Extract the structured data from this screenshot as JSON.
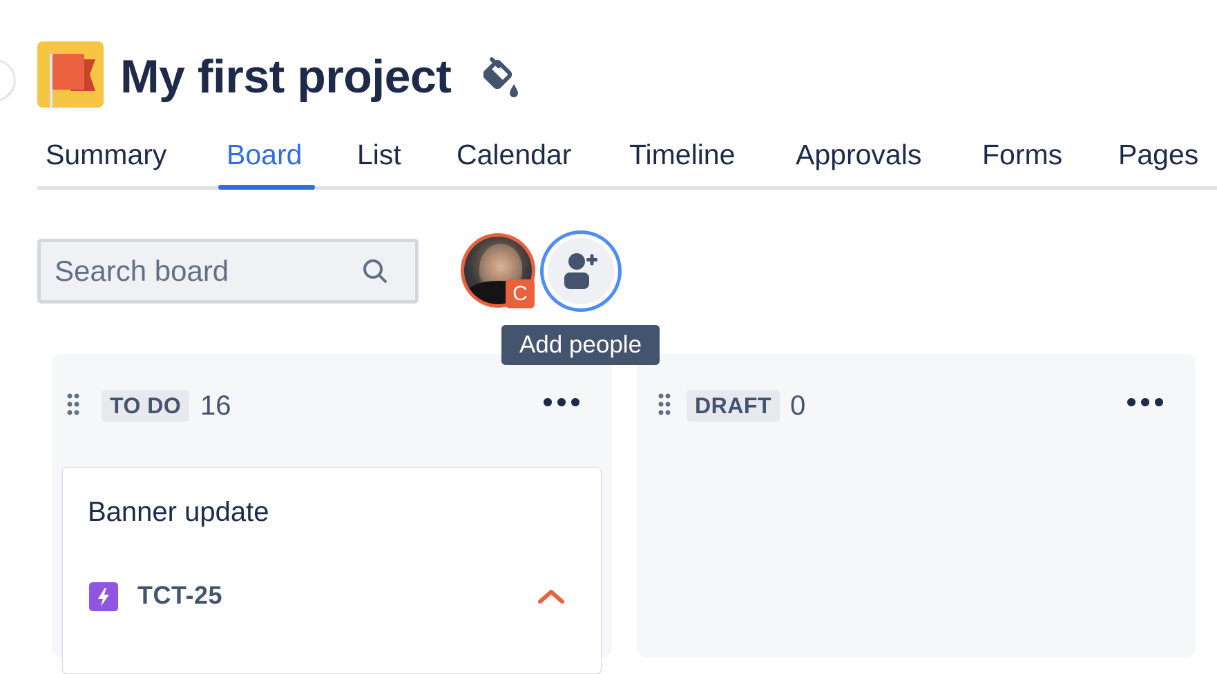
{
  "project": {
    "name": "My first project",
    "icon": "flag-icon",
    "theme_icon": "paint-bucket-icon"
  },
  "tabs": [
    {
      "label": "Summary",
      "active": false
    },
    {
      "label": "Board",
      "active": true
    },
    {
      "label": "List",
      "active": false
    },
    {
      "label": "Calendar",
      "active": false
    },
    {
      "label": "Timeline",
      "active": false
    },
    {
      "label": "Approvals",
      "active": false
    },
    {
      "label": "Forms",
      "active": false
    },
    {
      "label": "Pages",
      "active": false
    }
  ],
  "toolbar": {
    "search": {
      "placeholder": "Search board",
      "value": ""
    },
    "avatar": {
      "badge": "C"
    },
    "add_people": {
      "tooltip": "Add people"
    }
  },
  "columns": [
    {
      "name": "TO DO",
      "count": "16",
      "cards": [
        {
          "title": "Banner update",
          "key": "TCT-25",
          "type": "epic-lightning-icon",
          "priority": "high"
        }
      ]
    },
    {
      "name": "DRAFT",
      "count": "0",
      "cards": []
    }
  ],
  "colors": {
    "accent": "#2f6fdc",
    "avatar_ring": "#e9613d",
    "add_people_ring": "#4c8ef7",
    "epic_purple": "#8f55e0",
    "priority_high": "#e9613d",
    "tooltip_bg": "#44546f"
  }
}
